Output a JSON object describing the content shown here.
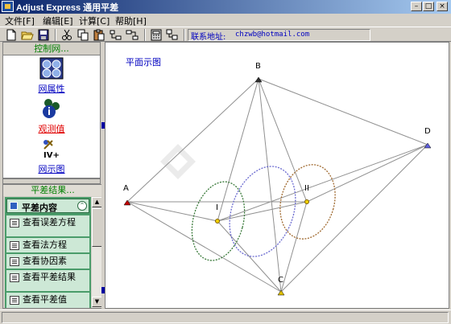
{
  "window": {
    "title": "Adjust Express 通用平差"
  },
  "menu": {
    "file": "文件[F]",
    "edit": "编辑[E]",
    "calc": "计算[C]",
    "help": "帮助[H]"
  },
  "toolbar": {
    "contact_label": "联系地址:",
    "contact_email": "chzwb@hotmail.com"
  },
  "sidebar": {
    "control_header": "控制网...",
    "items": [
      {
        "label": "网属性",
        "icon": "network-properties-icon"
      },
      {
        "label": "观测值",
        "icon": "observations-icon"
      },
      {
        "label": "网示图",
        "icon": "network-diagram-icon"
      }
    ],
    "iv_badge": "IV+",
    "results_header": "平差结果...",
    "panel_title": "平差内容",
    "result_items": [
      "查看误差方程",
      "查看法方程",
      "查看协因素",
      "查看平差结果",
      "查看平差值"
    ]
  },
  "canvas": {
    "title": "平面示图",
    "points": {
      "A": "A",
      "B": "B",
      "C": "C",
      "D": "D",
      "I": "I",
      "II": "II"
    }
  },
  "colors": {
    "title_gradient_start": "#0a246a",
    "title_gradient_end": "#a6caf0",
    "accent_green": "#4a9c6a",
    "link_red": "#e00000",
    "link_blue": "#0000c0"
  }
}
